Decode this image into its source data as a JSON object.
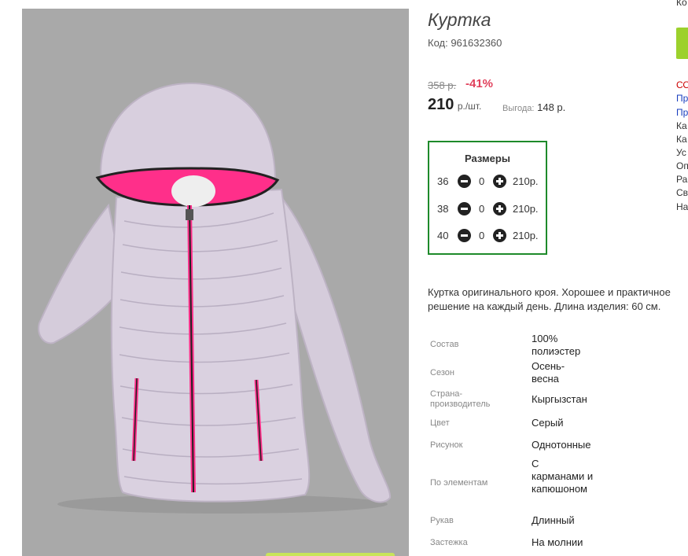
{
  "product": {
    "title": "Куртка",
    "code": "Код: 961632360",
    "old_price": "358 р.",
    "discount": "-41%",
    "price": "210",
    "price_unit": "р./шт.",
    "savings_label": "Выгода:",
    "savings_value": "148 р."
  },
  "sizes": {
    "title": "Размеры",
    "rows": [
      {
        "size": "36",
        "qty": "0",
        "price": "210р."
      },
      {
        "size": "38",
        "qty": "0",
        "price": "210р."
      },
      {
        "size": "40",
        "qty": "0",
        "price": "210р."
      }
    ]
  },
  "description": "Куртка оригинального кроя. Хорошее и практичное решение на каждый день. Длина изделия: 60 см.",
  "attributes": [
    {
      "label": "Состав",
      "value": "100% полиэстер"
    },
    {
      "label": "Сезон",
      "value": "Осень-весна"
    },
    {
      "label": "Страна-производитель",
      "value": "Кыргызстан"
    },
    {
      "label": "Цвет",
      "value": "Серый"
    },
    {
      "label": "Рисунок",
      "value": "Однотонные"
    },
    {
      "label": "По элементам",
      "value": "С карманами и капюшоном"
    },
    {
      "label": "Рукав",
      "value": "Длинный"
    },
    {
      "label": "Застежка",
      "value": "На молнии"
    }
  ],
  "right_column": {
    "top": "Ко",
    "items": [
      "СО",
      "Пр",
      "Пр",
      "Ка",
      "Ка",
      "Ус",
      "Оп",
      "Ра",
      "Св",
      "На"
    ]
  },
  "colors": {
    "photo_bg": "#a9a9a9",
    "jacket": "#d8cfde",
    "lining": "#ff2f8a",
    "sizes_border": "#1e8a2a",
    "discount": "#e0405b",
    "accent_green": "#9cd12c",
    "link_blue": "#1a3fbf",
    "link_red": "#cc0000"
  }
}
